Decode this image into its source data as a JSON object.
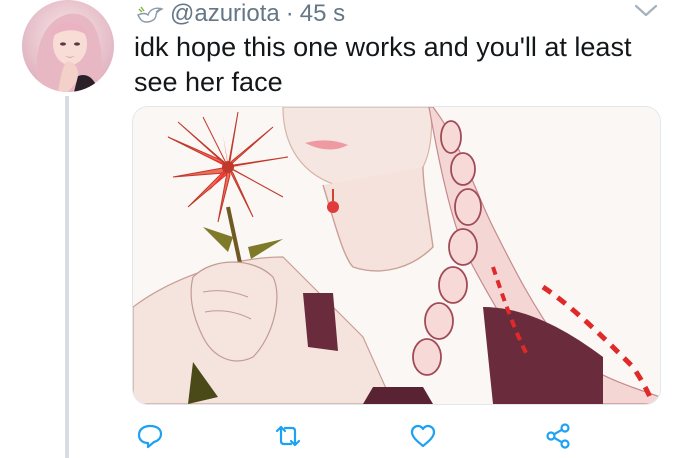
{
  "tweet": {
    "handle": "@azuriota",
    "separator": "·",
    "time": "45 s",
    "text": "idk hope this one works and you'll at least see her face",
    "icons": {
      "badge": "dove-icon",
      "menu": "chevron-down-icon"
    }
  },
  "actions": [
    {
      "name": "reply-button",
      "icon": "reply-icon"
    },
    {
      "name": "retweet-button",
      "icon": "retweet-icon"
    },
    {
      "name": "like-button",
      "icon": "heart-icon"
    },
    {
      "name": "share-button",
      "icon": "share-icon"
    }
  ],
  "colors": {
    "text": "#14171a",
    "secondary": "#657786",
    "icon": "#1da1f2"
  }
}
